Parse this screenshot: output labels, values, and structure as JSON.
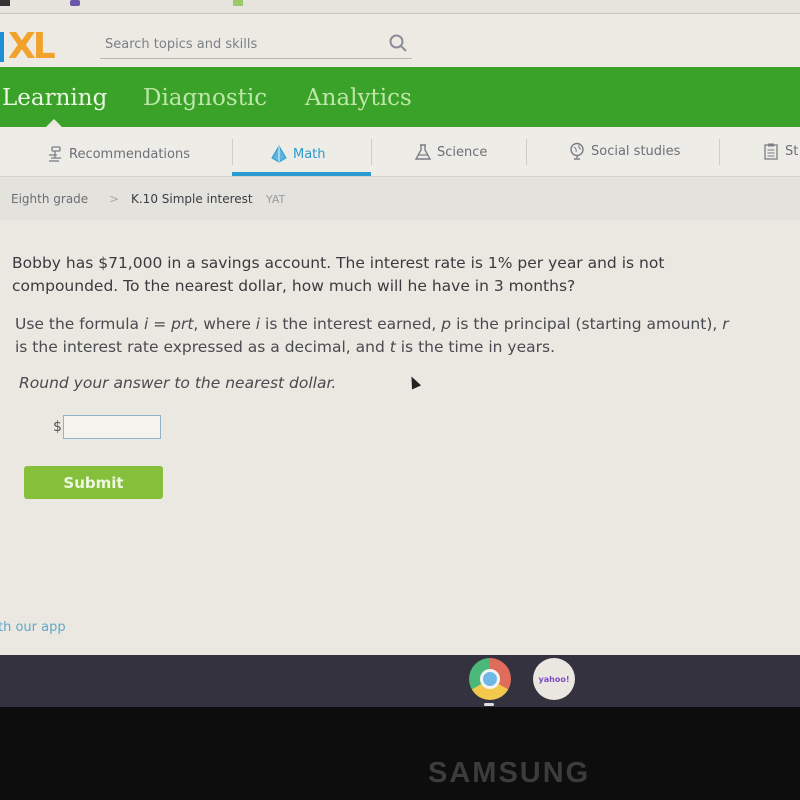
{
  "app": {
    "logo_text": "XL",
    "search": {
      "placeholder": "Search topics and skills",
      "value": ""
    },
    "main_nav": [
      {
        "label": "Learning",
        "active": true
      },
      {
        "label": "Diagnostic",
        "active": false
      },
      {
        "label": "Analytics",
        "active": false
      }
    ],
    "subjects": [
      {
        "label": "Recommendations",
        "icon": "recommendations-icon",
        "active": false
      },
      {
        "label": "Math",
        "icon": "pyramid-icon",
        "active": true
      },
      {
        "label": "Science",
        "icon": "flask-icon",
        "active": false
      },
      {
        "label": "Social studies",
        "icon": "globe-icon",
        "active": false
      },
      {
        "label": "St",
        "icon": "clipboard-icon",
        "active": false
      }
    ],
    "breadcrumb": {
      "grade": "Eighth grade",
      "separator": ">",
      "skill": "K.10 Simple interest",
      "code": "YAT"
    },
    "question": {
      "main": "Bobby has $71,000 in a savings account. The interest rate is 1% per year and is not compounded. To the nearest dollar, how much will he have in 3 months?",
      "formula_parts": {
        "a": "Use the formula ",
        "i1": "i",
        "b": " = ",
        "prt": "prt",
        "c": ", where ",
        "i2": "i",
        "d": " is the interest earned, ",
        "p": "p",
        "e": " is the principal (starting amount), ",
        "r": "r",
        "f": "is the interest rate expressed as a decimal, and ",
        "t": "t",
        "g": " is the time in years."
      },
      "round_instruction": "Round your answer to the nearest dollar."
    },
    "answer": {
      "prefix": "$",
      "value": ""
    },
    "submit_label": "Submit",
    "app_link": "th our app",
    "colors": {
      "green_nav": "#3aa228",
      "math_accent": "#2a9ad0",
      "submit": "#86c03a",
      "logo_orange": "#f2a22a",
      "logo_blue": "#1e8fd6"
    }
  },
  "shelf": {
    "apps": [
      {
        "name": "Chrome"
      },
      {
        "name": "Yahoo",
        "label": "yahoo!"
      }
    ]
  },
  "device": {
    "brand": "SAMSUNG"
  }
}
